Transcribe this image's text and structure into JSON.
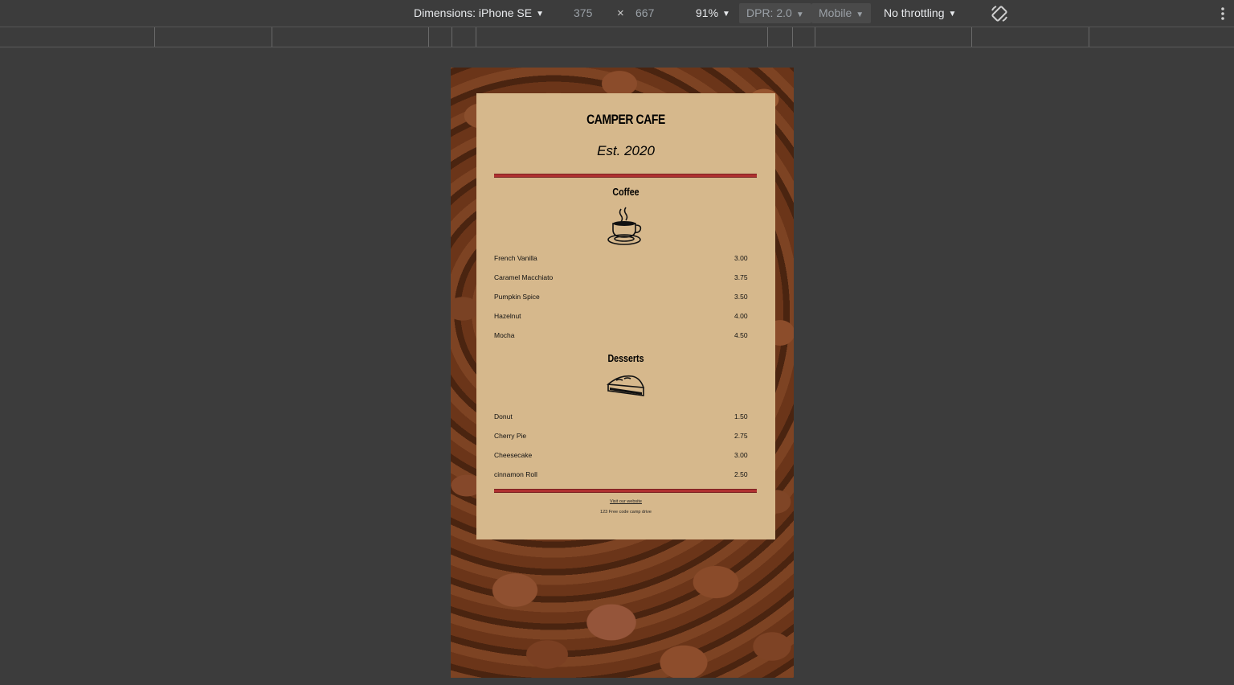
{
  "toolbar": {
    "dimensions_label": "Dimensions: iPhone SE",
    "width": "375",
    "times": "×",
    "height": "667",
    "zoom": "91%",
    "dpr": "DPR: 2.0",
    "mode": "Mobile",
    "throttling": "No throttling"
  },
  "menu": {
    "cafe_name": "CAMPER CAFE",
    "established": "Est. 2020",
    "coffee": {
      "title": "Coffee",
      "items": [
        {
          "name": "French Vanilla",
          "price": "3.00"
        },
        {
          "name": "Caramel Macchiato",
          "price": "3.75"
        },
        {
          "name": "Pumpkin Spice",
          "price": "3.50"
        },
        {
          "name": "Hazelnut",
          "price": "4.00"
        },
        {
          "name": "Mocha",
          "price": "4.50"
        }
      ]
    },
    "desserts": {
      "title": "Desserts",
      "items": [
        {
          "name": "Donut",
          "price": "1.50"
        },
        {
          "name": "Cherry Pie",
          "price": "2.75"
        },
        {
          "name": "Cheesecake",
          "price": "3.00"
        },
        {
          "name": "cinnamon Roll",
          "price": "2.50"
        }
      ]
    },
    "footer": {
      "link": "Visit our website",
      "address": "123 Free code camp drive"
    }
  }
}
